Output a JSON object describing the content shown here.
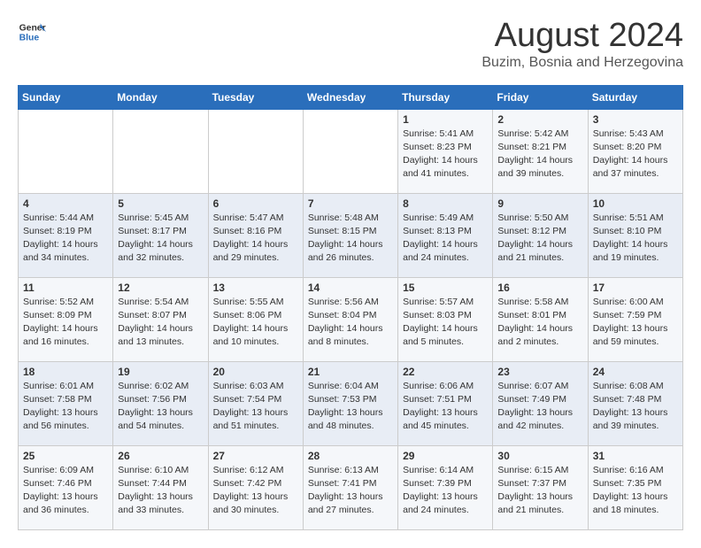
{
  "header": {
    "logo_general": "General",
    "logo_blue": "Blue",
    "main_title": "August 2024",
    "subtitle": "Buzim, Bosnia and Herzegovina"
  },
  "calendar": {
    "weekdays": [
      "Sunday",
      "Monday",
      "Tuesday",
      "Wednesday",
      "Thursday",
      "Friday",
      "Saturday"
    ],
    "weeks": [
      [
        {
          "day": "",
          "info": ""
        },
        {
          "day": "",
          "info": ""
        },
        {
          "day": "",
          "info": ""
        },
        {
          "day": "",
          "info": ""
        },
        {
          "day": "1",
          "info": "Sunrise: 5:41 AM\nSunset: 8:23 PM\nDaylight: 14 hours\nand 41 minutes."
        },
        {
          "day": "2",
          "info": "Sunrise: 5:42 AM\nSunset: 8:21 PM\nDaylight: 14 hours\nand 39 minutes."
        },
        {
          "day": "3",
          "info": "Sunrise: 5:43 AM\nSunset: 8:20 PM\nDaylight: 14 hours\nand 37 minutes."
        }
      ],
      [
        {
          "day": "4",
          "info": "Sunrise: 5:44 AM\nSunset: 8:19 PM\nDaylight: 14 hours\nand 34 minutes."
        },
        {
          "day": "5",
          "info": "Sunrise: 5:45 AM\nSunset: 8:17 PM\nDaylight: 14 hours\nand 32 minutes."
        },
        {
          "day": "6",
          "info": "Sunrise: 5:47 AM\nSunset: 8:16 PM\nDaylight: 14 hours\nand 29 minutes."
        },
        {
          "day": "7",
          "info": "Sunrise: 5:48 AM\nSunset: 8:15 PM\nDaylight: 14 hours\nand 26 minutes."
        },
        {
          "day": "8",
          "info": "Sunrise: 5:49 AM\nSunset: 8:13 PM\nDaylight: 14 hours\nand 24 minutes."
        },
        {
          "day": "9",
          "info": "Sunrise: 5:50 AM\nSunset: 8:12 PM\nDaylight: 14 hours\nand 21 minutes."
        },
        {
          "day": "10",
          "info": "Sunrise: 5:51 AM\nSunset: 8:10 PM\nDaylight: 14 hours\nand 19 minutes."
        }
      ],
      [
        {
          "day": "11",
          "info": "Sunrise: 5:52 AM\nSunset: 8:09 PM\nDaylight: 14 hours\nand 16 minutes."
        },
        {
          "day": "12",
          "info": "Sunrise: 5:54 AM\nSunset: 8:07 PM\nDaylight: 14 hours\nand 13 minutes."
        },
        {
          "day": "13",
          "info": "Sunrise: 5:55 AM\nSunset: 8:06 PM\nDaylight: 14 hours\nand 10 minutes."
        },
        {
          "day": "14",
          "info": "Sunrise: 5:56 AM\nSunset: 8:04 PM\nDaylight: 14 hours\nand 8 minutes."
        },
        {
          "day": "15",
          "info": "Sunrise: 5:57 AM\nSunset: 8:03 PM\nDaylight: 14 hours\nand 5 minutes."
        },
        {
          "day": "16",
          "info": "Sunrise: 5:58 AM\nSunset: 8:01 PM\nDaylight: 14 hours\nand 2 minutes."
        },
        {
          "day": "17",
          "info": "Sunrise: 6:00 AM\nSunset: 7:59 PM\nDaylight: 13 hours\nand 59 minutes."
        }
      ],
      [
        {
          "day": "18",
          "info": "Sunrise: 6:01 AM\nSunset: 7:58 PM\nDaylight: 13 hours\nand 56 minutes."
        },
        {
          "day": "19",
          "info": "Sunrise: 6:02 AM\nSunset: 7:56 PM\nDaylight: 13 hours\nand 54 minutes."
        },
        {
          "day": "20",
          "info": "Sunrise: 6:03 AM\nSunset: 7:54 PM\nDaylight: 13 hours\nand 51 minutes."
        },
        {
          "day": "21",
          "info": "Sunrise: 6:04 AM\nSunset: 7:53 PM\nDaylight: 13 hours\nand 48 minutes."
        },
        {
          "day": "22",
          "info": "Sunrise: 6:06 AM\nSunset: 7:51 PM\nDaylight: 13 hours\nand 45 minutes."
        },
        {
          "day": "23",
          "info": "Sunrise: 6:07 AM\nSunset: 7:49 PM\nDaylight: 13 hours\nand 42 minutes."
        },
        {
          "day": "24",
          "info": "Sunrise: 6:08 AM\nSunset: 7:48 PM\nDaylight: 13 hours\nand 39 minutes."
        }
      ],
      [
        {
          "day": "25",
          "info": "Sunrise: 6:09 AM\nSunset: 7:46 PM\nDaylight: 13 hours\nand 36 minutes."
        },
        {
          "day": "26",
          "info": "Sunrise: 6:10 AM\nSunset: 7:44 PM\nDaylight: 13 hours\nand 33 minutes."
        },
        {
          "day": "27",
          "info": "Sunrise: 6:12 AM\nSunset: 7:42 PM\nDaylight: 13 hours\nand 30 minutes."
        },
        {
          "day": "28",
          "info": "Sunrise: 6:13 AM\nSunset: 7:41 PM\nDaylight: 13 hours\nand 27 minutes."
        },
        {
          "day": "29",
          "info": "Sunrise: 6:14 AM\nSunset: 7:39 PM\nDaylight: 13 hours\nand 24 minutes."
        },
        {
          "day": "30",
          "info": "Sunrise: 6:15 AM\nSunset: 7:37 PM\nDaylight: 13 hours\nand 21 minutes."
        },
        {
          "day": "31",
          "info": "Sunrise: 6:16 AM\nSunset: 7:35 PM\nDaylight: 13 hours\nand 18 minutes."
        }
      ]
    ]
  }
}
